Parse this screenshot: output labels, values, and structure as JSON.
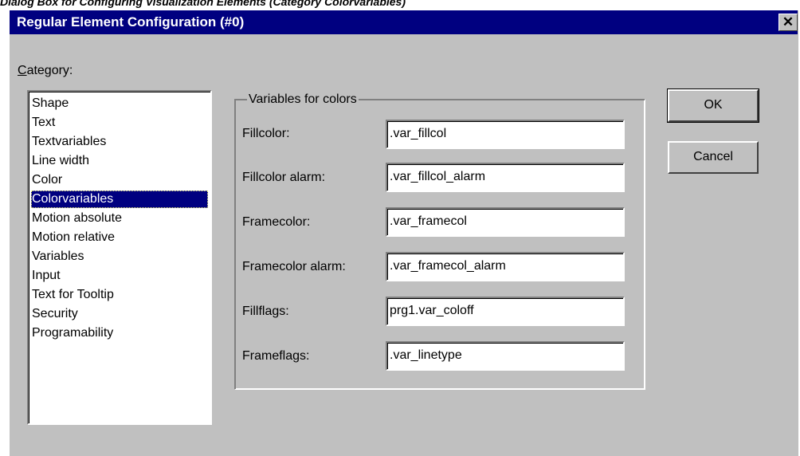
{
  "caption": "Dialog Box for Configuring Visualization Elements (Category Colorvariables)",
  "dialog": {
    "title": "Regular Element Configuration (#0)",
    "close_glyph": "✕"
  },
  "category": {
    "label_access_key": "C",
    "label_rest": "ategory:",
    "items": [
      "Shape",
      "Text",
      "Textvariables",
      "Line width",
      "Color",
      "Colorvariables",
      "Motion absolute",
      "Motion relative",
      "Variables",
      "Input",
      "Text for Tooltip",
      "Security",
      "Programability"
    ],
    "selected": "Colorvariables"
  },
  "group": {
    "legend": "Variables for colors",
    "fields": [
      {
        "label": "Fillcolor:",
        "value": ".var_fillcol"
      },
      {
        "label": "Fillcolor alarm:",
        "value": ".var_fillcol_alarm"
      },
      {
        "label": "Framecolor:",
        "value": ".var_framecol"
      },
      {
        "label": "Framecolor alarm:",
        "value": ".var_framecol_alarm"
      },
      {
        "label": "Fillflags:",
        "value": "prg1.var_coloff"
      },
      {
        "label": "Frameflags:",
        "value": ".var_linetype"
      }
    ]
  },
  "buttons": {
    "ok": "OK",
    "cancel": "Cancel"
  },
  "colors": {
    "titlebar": "#000080",
    "face": "#c0c0c0",
    "selection": "#000080"
  }
}
